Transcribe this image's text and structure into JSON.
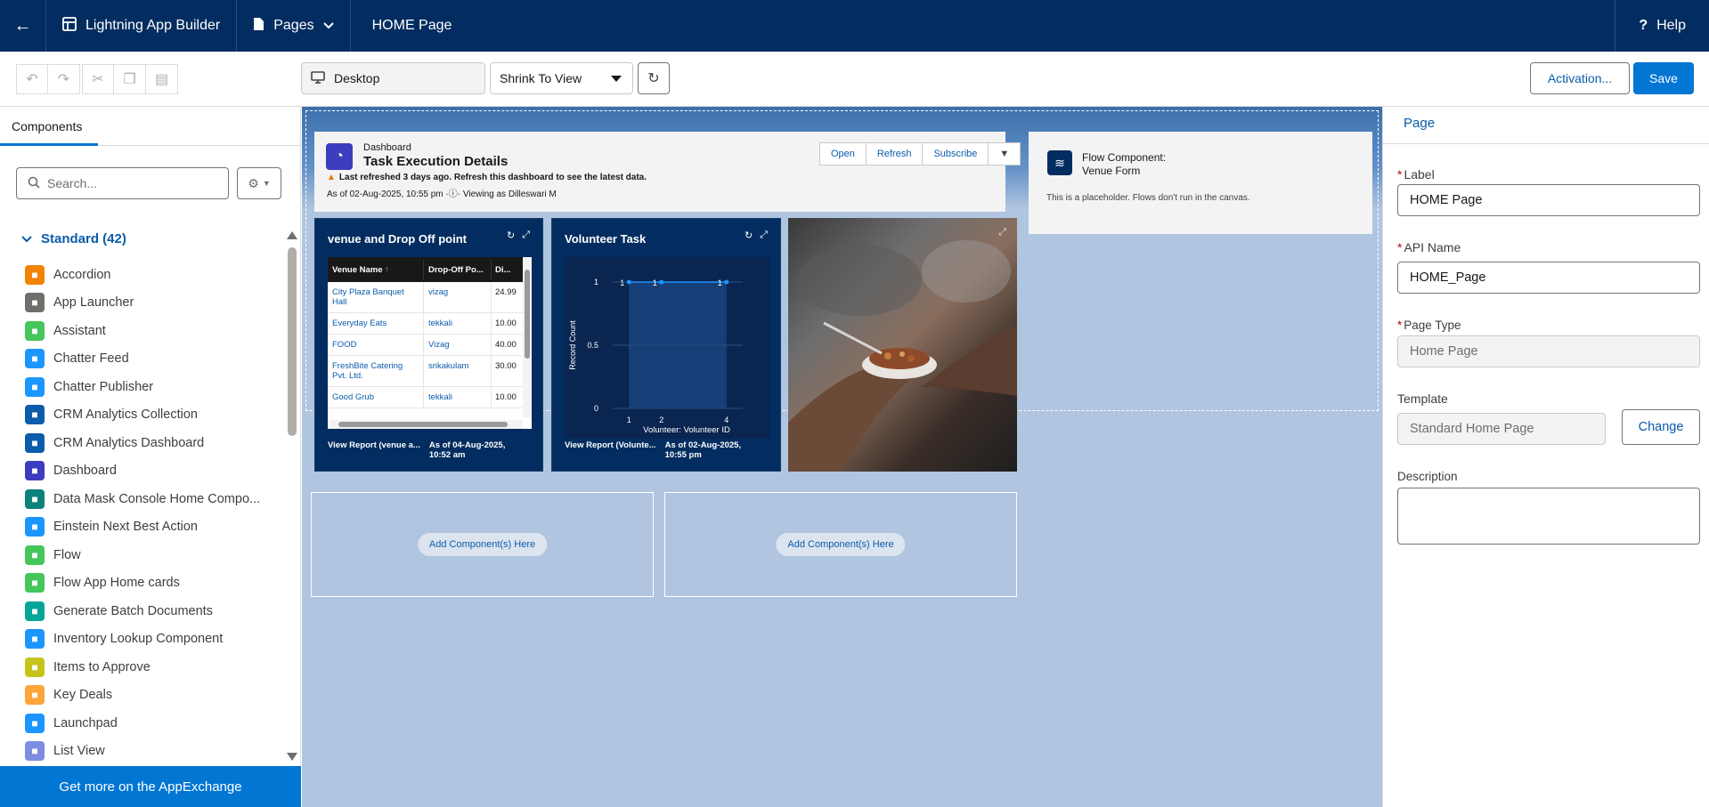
{
  "topbar": {
    "app_name": "Lightning App Builder",
    "pages_label": "Pages",
    "page_title": "HOME Page",
    "help_label": "Help"
  },
  "toolbar": {
    "device": "Desktop",
    "view_mode": "Shrink To View",
    "activation_label": "Activation...",
    "save_label": "Save"
  },
  "left_panel": {
    "tab": "Components",
    "search_placeholder": "Search...",
    "section_title": "Standard (42)",
    "items": [
      {
        "label": "Accordion",
        "icon": "accordion-icon",
        "color": "#f38303"
      },
      {
        "label": "App Launcher",
        "icon": "app-launcher-icon",
        "color": "#706e6b"
      },
      {
        "label": "Assistant",
        "icon": "assistant-icon",
        "color": "#45c65a"
      },
      {
        "label": "Chatter Feed",
        "icon": "chatter-feed-icon",
        "color": "#1b96ff"
      },
      {
        "label": "Chatter Publisher",
        "icon": "chatter-publisher-icon",
        "color": "#1b96ff"
      },
      {
        "label": "CRM Analytics Collection",
        "icon": "analytics-collection-icon",
        "color": "#0b5cab"
      },
      {
        "label": "CRM Analytics Dashboard",
        "icon": "analytics-dashboard-icon",
        "color": "#0b5cab"
      },
      {
        "label": "Dashboard",
        "icon": "dashboard-icon",
        "color": "#3c3cbf"
      },
      {
        "label": "Data Mask Console Home Compo...",
        "icon": "data-mask-icon",
        "color": "#0b827c"
      },
      {
        "label": "Einstein Next Best Action",
        "icon": "einstein-icon",
        "color": "#1b96ff"
      },
      {
        "label": "Flow",
        "icon": "flow-icon",
        "color": "#45c65a"
      },
      {
        "label": "Flow App Home cards",
        "icon": "flow-cards-icon",
        "color": "#45c65a"
      },
      {
        "label": "Generate Batch Documents",
        "icon": "batch-documents-icon",
        "color": "#06a59a"
      },
      {
        "label": "Inventory Lookup Component",
        "icon": "inventory-icon",
        "color": "#1b96ff"
      },
      {
        "label": "Items to Approve",
        "icon": "approve-icon",
        "color": "#c6c41a"
      },
      {
        "label": "Key Deals",
        "icon": "key-deals-icon",
        "color": "#fca53a"
      },
      {
        "label": "Launchpad",
        "icon": "launchpad-icon",
        "color": "#1b96ff"
      },
      {
        "label": "List View",
        "icon": "list-view-icon",
        "color": "#7f8de1"
      }
    ],
    "appexchange": "Get more on the AppExchange"
  },
  "canvas": {
    "dashboard": {
      "kicker": "Dashboard",
      "title": "Task Execution Details",
      "warning": "Last refreshed 3 days ago. Refresh this dashboard to see the latest data.",
      "as_of": "As of 02-Aug-2025, 10:55 pm",
      "viewing": "Viewing as Dilleswari M",
      "buttons": [
        "Open",
        "Refresh",
        "Subscribe"
      ]
    },
    "venue_widget": {
      "title": "venue and Drop Off point",
      "columns": [
        "Venue Name",
        "Drop-Off Po...",
        "Di..."
      ],
      "rows": [
        {
          "venue": "City Plaza Banquet Hall",
          "dropoff": "vizag",
          "value": "24.99"
        },
        {
          "venue": "Everyday Eats",
          "dropoff": "tekkali",
          "value": "10.00"
        },
        {
          "venue": "FOOD",
          "dropoff": "Vizag",
          "value": "40.00"
        },
        {
          "venue": "FreshBite Catering Pvt. Ltd.",
          "dropoff": "srikakulam",
          "value": "30.00"
        },
        {
          "venue": "Good Grub",
          "dropoff": "tekkali",
          "value": "10.00"
        }
      ],
      "footer_link": "View Report (venue a...",
      "footer_time": "As of 04-Aug-2025, 10:52 am"
    },
    "volunteer_widget": {
      "title": "Volunteer Task",
      "footer_link": "View Report (Volunte...",
      "footer_time": "As of 02-Aug-2025, 10:55 pm"
    },
    "add_component": "Add Component(s) Here",
    "flow": {
      "line1": "Flow Component:",
      "line2": "Venue Form",
      "note": "This is a placeholder. Flows don't run in the canvas."
    }
  },
  "chart_data": {
    "type": "line",
    "x": [
      1,
      2,
      4
    ],
    "values": [
      1,
      1,
      1
    ],
    "data_labels": [
      "1",
      "1",
      "1"
    ],
    "xlabel": "Volunteer: Volunteer ID",
    "ylabel": "Record Count",
    "y_ticks": [
      "1",
      "0.5",
      "0"
    ],
    "x_ticks": [
      "1",
      "2",
      "4"
    ],
    "ylim": [
      0,
      1
    ]
  },
  "right_panel": {
    "title": "Page",
    "label_label": "Label",
    "label_value": "HOME Page",
    "api_label": "API Name",
    "api_value": "HOME_Page",
    "type_label": "Page Type",
    "type_value": "Home Page",
    "template_label": "Template",
    "template_value": "Standard Home Page",
    "change_label": "Change",
    "description_label": "Description"
  }
}
